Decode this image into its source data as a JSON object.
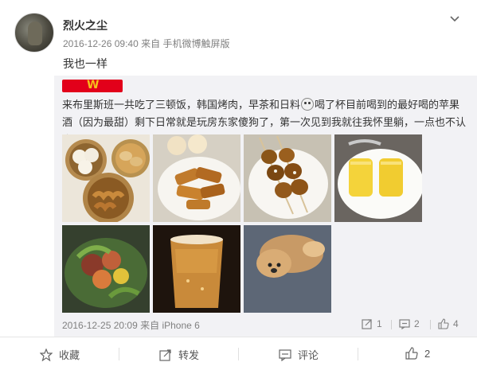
{
  "post": {
    "username": "烈火之尘",
    "timestamp": "2016-12-26 09:40",
    "source_prefix": "来自",
    "source": "手机微博触屏版",
    "text": "我也一样"
  },
  "quoted": {
    "flag_letter": "W",
    "text_part1": "来布里斯班一共吃了三顿饭，韩国烤肉，早茶和日料",
    "text_part2": "喝了杯目前喝到的最好喝的苹果酒（因为最甜）剩下日常就是玩房东家傻狗了，第一次见到我就往我怀里躺，一点也不认生",
    "timestamp": "2016-12-25 20:09",
    "source_prefix": "来自",
    "source": "iPhone 6",
    "repost_count": "1",
    "comment_count": "2",
    "like_count": "4"
  },
  "actions": {
    "favorite": "收藏",
    "repost": "转发",
    "comment": "评论",
    "like_count": "2"
  },
  "icons": {
    "chevron": "chevron-down-icon",
    "favorite": "star-icon",
    "repost": "share-icon",
    "comment": "comment-icon",
    "like": "thumbs-up-icon"
  },
  "colors": {
    "flag_red": "#e2001a",
    "flag_yellow": "#f6c11a",
    "quote_bg": "#f2f2f5",
    "meta_gray": "#808080"
  }
}
